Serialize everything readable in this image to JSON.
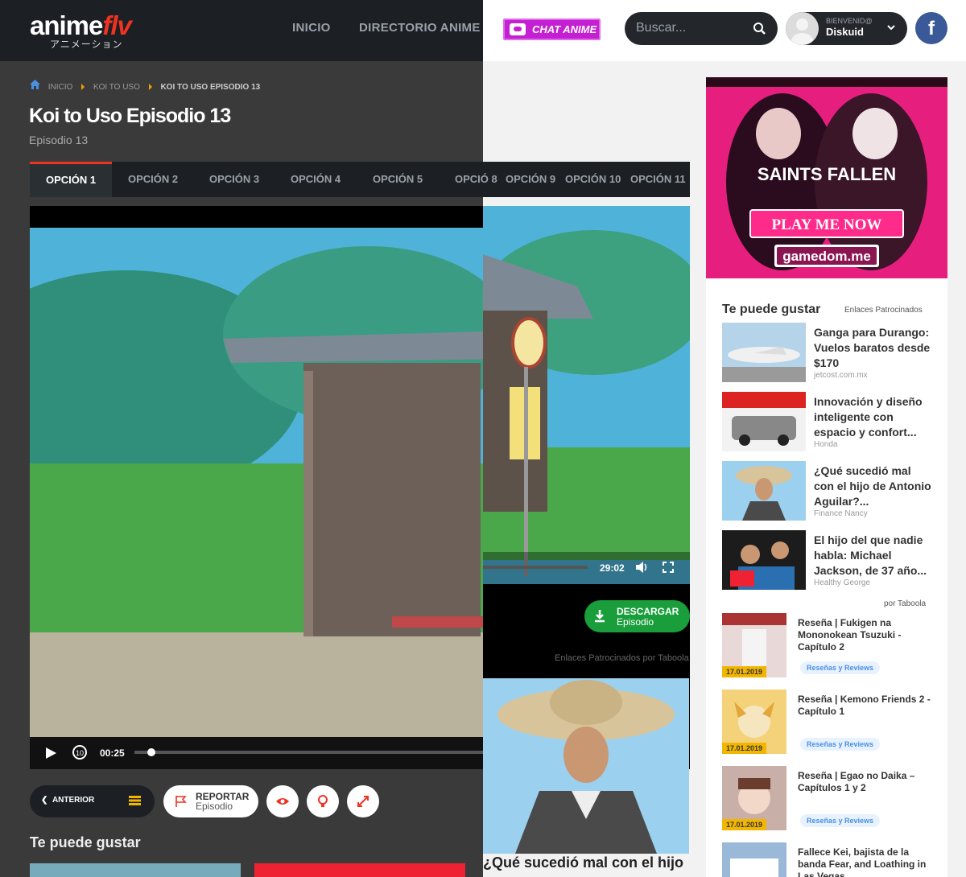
{
  "header": {
    "logo": "animeflv",
    "logo_flv": "flv",
    "logo_sub": "アニメーション",
    "nav_inicio": "INICIO",
    "nav_directorio": "DIRECTORIO ANIME",
    "chat_label": "CHAT ANIME",
    "search_placeholder": "Buscar...",
    "welcome": "BIENVENID@",
    "username": "Diskuid",
    "fb": "f"
  },
  "breadcrumb": {
    "inicio": "INICIO",
    "serie": "KOI TO USO",
    "current": "KOI TO USO EPISODIO 13"
  },
  "episode": {
    "title": "Koi to Uso Episodio 13",
    "subtitle": "Episodio 13"
  },
  "tabs": [
    "OPCIÓN 1",
    "OPCIÓN 2",
    "OPCIÓN 3",
    "OPCIÓN 4",
    "OPCIÓN 5",
    "OPCIÓ 8",
    "OPCIÓN 9",
    "OPCIÓN 10",
    "OPCIÓN 11"
  ],
  "player": {
    "time_current": "00:25",
    "time_total": "29:02",
    "progress": 0.03
  },
  "download": {
    "label": "DESCARGAR",
    "sub": "Episodio"
  },
  "enlaces": "Enlaces Patrocinados por Taboola",
  "controls": {
    "prev": "ANTERIOR",
    "report": "REPORTAR",
    "report_sub": "Episodio"
  },
  "te_puede_gustar": "Te puede gustar",
  "bigad_caption": "¿Qué sucedió mal con el hijo",
  "sidebar": {
    "ad_text1": "SAINTS FALLEN",
    "ad_text2": "PLAY ME NOW",
    "ad_text3": "gamedom.me",
    "heading": "Te puede gustar",
    "sponsored": "Enlaces Patrocinados",
    "items": [
      {
        "title": "Ganga para Durango: Vuelos baratos desde $170",
        "source": "jetcost.com.mx"
      },
      {
        "title": "Innovación y diseño inteligente con espacio y confort...",
        "source": "Honda"
      },
      {
        "title": "¿Qué sucedió mal con el hijo de Antonio Aguilar?...",
        "source": "Finance Nancy"
      },
      {
        "title": "El hijo del que nadie habla: Michael Jackson, de 37 año...",
        "source": "Healthy George"
      }
    ],
    "taboola": "por Taboola",
    "reviews": [
      {
        "title": "Reseña | Fukigen na Mononokean Tsuzuki - Capítulo 2",
        "date": "17.01.2019",
        "badge": "Reseñas y Reviews"
      },
      {
        "title": "Reseña | Kemono Friends 2 - Capítulo 1",
        "date": "17.01.2019",
        "badge": "Reseñas y Reviews"
      },
      {
        "title": "Reseña | Egao no Daika – Capítulos 1 y 2",
        "date": "17.01.2019",
        "badge": "Reseñas y Reviews"
      },
      {
        "title": "Fallece Kei, bajista de la banda Fear, and Loathing in Las Vegas",
        "date": "",
        "badge": ""
      }
    ]
  },
  "colors": {
    "accent": "#e32222",
    "download": "#1a9e3b",
    "date": "#f2b600"
  }
}
